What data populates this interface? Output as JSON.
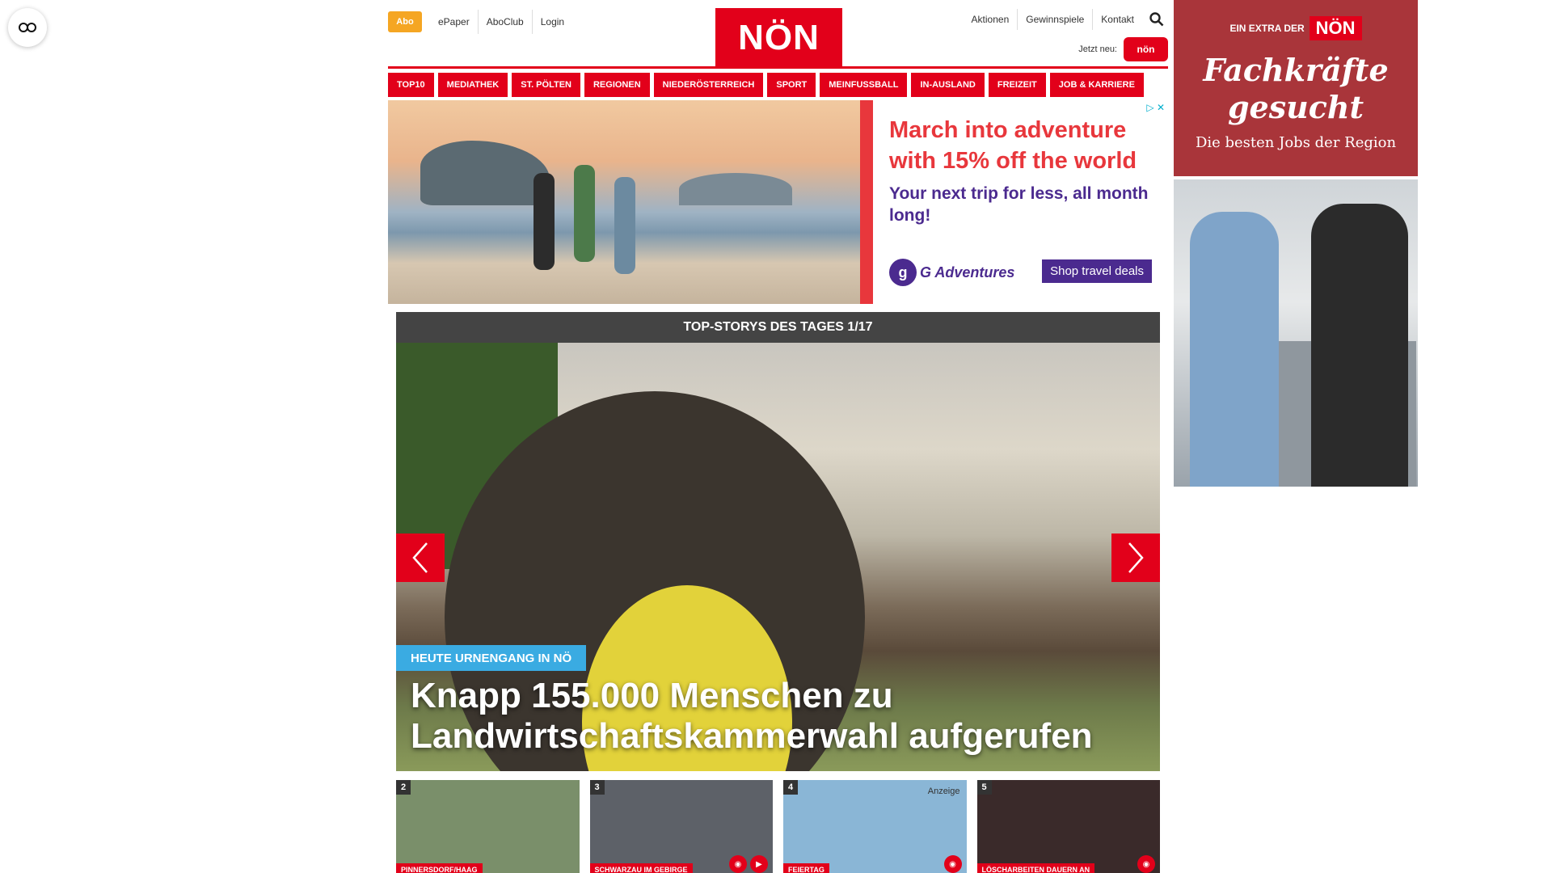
{
  "header": {
    "abo": "Abo",
    "left_links": [
      "ePaper",
      "AboClub",
      "Login"
    ],
    "logo": "NÖN",
    "right_links": [
      "Aktionen",
      "Gewinnspiele",
      "Kontakt"
    ],
    "jetzt_neu": "Jetzt neu:",
    "jetzt_badge": "nön"
  },
  "nav": [
    "TOP10",
    "MEDIATHEK",
    "ST. PÖLTEN",
    "REGIONEN",
    "NIEDERÖSTERREICH",
    "SPORT",
    "MEINFUSSBALL",
    "IN-AUSLAND",
    "FREIZEIT",
    "JOB & KARRIERE"
  ],
  "ad": {
    "headline": "March into adventure with 15% off the world",
    "sub": "Your next trip for less, all month long!",
    "brand": "G Adventures",
    "cta": "Shop travel deals"
  },
  "story": {
    "header": "TOP-STORYS DES TAGES 1/17",
    "kicker": "HEUTE URNENGANG IN NÖ",
    "headline": "Knapp 155.000 Menschen zu Landwirtschaftskammerwahl aufgerufen"
  },
  "thumbs": [
    {
      "num": "2",
      "label": "PINNERSDORF/HAAG",
      "bg": "#7a8f6a"
    },
    {
      "num": "3",
      "label": "SCHWARZAU IM GEBIRGE",
      "bg": "#5d6168"
    },
    {
      "num": "4",
      "label": "FEIERTAG",
      "bg": "#8ab6d6",
      "badge": "Anzeige"
    },
    {
      "num": "5",
      "label": "LÖSCHARBEITEN DAUERN AN",
      "bg": "#3a2a2a"
    }
  ],
  "side_ad": {
    "top": "EIN EXTRA DER",
    "logo": "NÖN",
    "headline": "Fachkräfte gesucht",
    "sub": "Die besten Jobs der Region"
  },
  "colors": {
    "brand": "#e2001a",
    "accent": "#3aabe2",
    "ad_purple": "#4b2a8f"
  }
}
